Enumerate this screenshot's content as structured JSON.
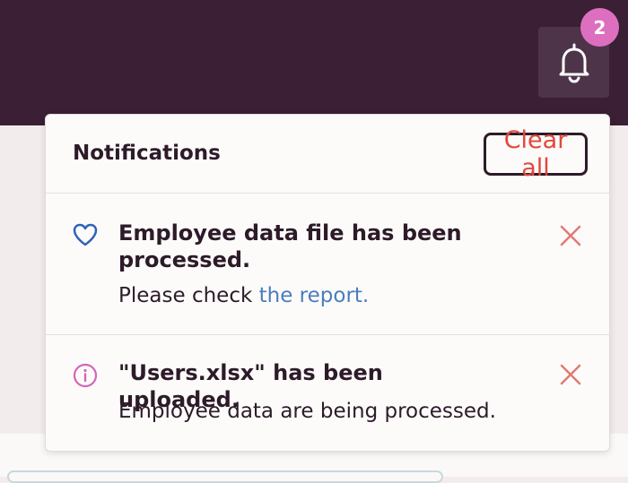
{
  "header": {
    "notification_count": "2",
    "bell_icon": "bell-icon"
  },
  "panel": {
    "title": "Notifications",
    "clear_all_label": "Clear all",
    "notifications": [
      {
        "icon": "heart-icon",
        "icon_color": "#2f62b7",
        "title": "Employee data file has been processed.",
        "body_prefix": "Please check ",
        "body_link": "the report.",
        "close_icon": "close-icon"
      },
      {
        "icon": "info-icon",
        "icon_color": "#d466b6",
        "title": "\"Users.xlsx\" has been uploaded.",
        "body": "Employee data are being processed.",
        "close_icon": "close-icon"
      }
    ]
  },
  "colors": {
    "topbar": "#3a1f35",
    "badge": "#de6fbf",
    "accent_red": "#e1473a",
    "link": "#4a7dbd"
  }
}
